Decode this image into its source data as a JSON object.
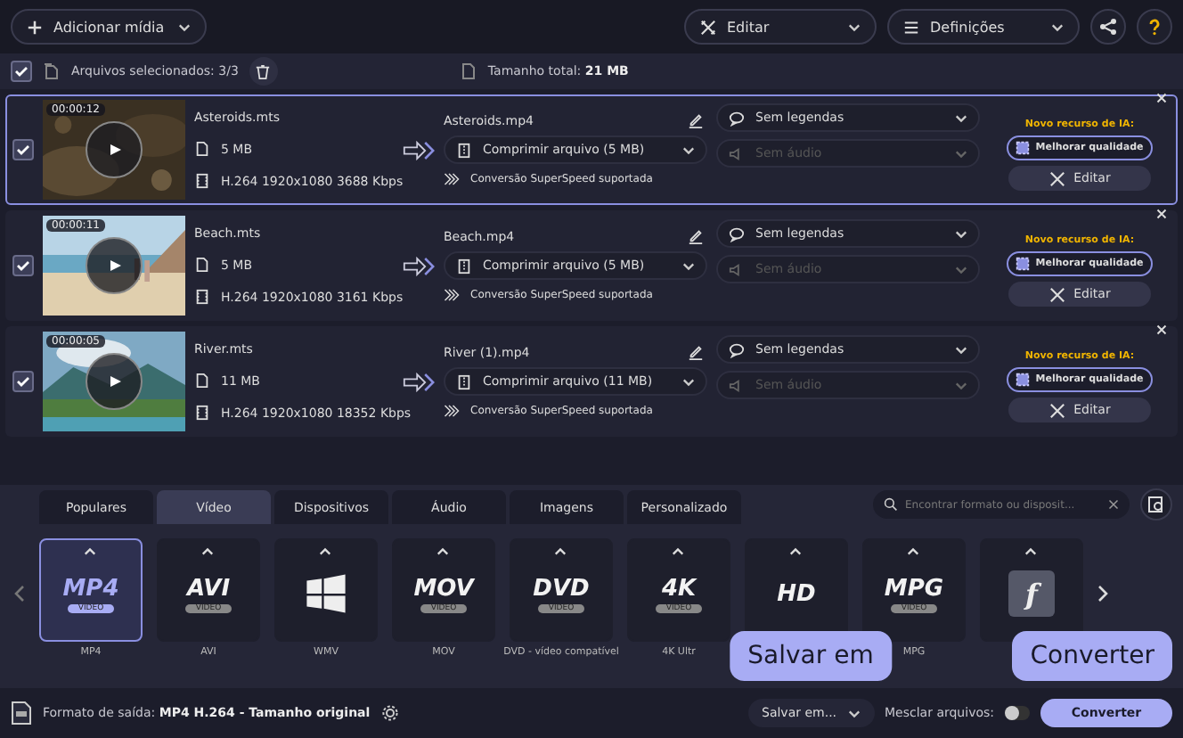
{
  "toolbar": {
    "add_media": "Adicionar mídia",
    "edit": "Editar",
    "settings": "Definições"
  },
  "selection_bar": {
    "checked": true,
    "selected_files": "Arquivos selecionados: 3/3",
    "total_label": "Tamanho total:",
    "total_value": "21 MB"
  },
  "files": [
    {
      "selected": true,
      "checked": true,
      "duration": "00:00:12",
      "source": "Asteroids.mts",
      "size": "5 MB",
      "codec": "H.264 1920x1080 3688 Kbps",
      "output": "Asteroids.mp4",
      "compress": "Comprimir arquivo (5 MB)",
      "speed": "Conversão SuperSpeed suportada",
      "subtitles": "Sem legendas",
      "audio": "Sem áudio",
      "audio_disabled": true,
      "ai_label": "Novo recurso de IA:",
      "enhance": "Melhorar qualidade",
      "edit": "Editar"
    },
    {
      "selected": false,
      "checked": true,
      "duration": "00:00:11",
      "source": "Beach.mts",
      "size": "5 MB",
      "codec": "H.264 1920x1080 3161 Kbps",
      "output": "Beach.mp4",
      "compress": "Comprimir arquivo (5 MB)",
      "speed": "Conversão SuperSpeed suportada",
      "subtitles": "Sem legendas",
      "audio": "Sem áudio",
      "audio_disabled": true,
      "ai_label": "Novo recurso de IA:",
      "enhance": "Melhorar qualidade",
      "edit": "Editar"
    },
    {
      "selected": false,
      "checked": true,
      "duration": "00:00:05",
      "source": "River.mts",
      "size": "11 MB",
      "codec": "H.264 1920x1080 18352 Kbps",
      "output": "River (1).mp4",
      "compress": "Comprimir arquivo (11 MB)",
      "speed": "Conversão SuperSpeed suportada",
      "subtitles": "Sem legendas",
      "audio": "Sem áudio",
      "audio_disabled": true,
      "ai_label": "Novo recurso de IA:",
      "enhance": "Melhorar qualidade",
      "edit": "Editar"
    }
  ],
  "format_tabs": [
    {
      "label": "Populares",
      "selected": false
    },
    {
      "label": "Vídeo",
      "selected": true
    },
    {
      "label": "Dispositivos",
      "selected": false
    },
    {
      "label": "Áudio",
      "selected": false
    },
    {
      "label": "Imagens",
      "selected": false
    },
    {
      "label": "Personalizado",
      "selected": false
    }
  ],
  "format_search": {
    "placeholder": "Encontrar formato ou disposit..."
  },
  "formats": [
    {
      "kind": "text",
      "logo": "MP4",
      "sub": "VIDEO",
      "label": "MP4",
      "selected": true
    },
    {
      "kind": "text",
      "logo": "AVI",
      "sub": "VIDEO",
      "label": "AVI",
      "selected": false
    },
    {
      "kind": "windows",
      "label": "WMV",
      "selected": false
    },
    {
      "kind": "text",
      "logo": "MOV",
      "sub": "VIDEO",
      "label": "MOV",
      "selected": false
    },
    {
      "kind": "text",
      "logo": "DVD",
      "sub": "VIDEO",
      "label": "DVD - vídeo compatível",
      "selected": false
    },
    {
      "kind": "text",
      "logo": "4K",
      "sub": "VIDEO",
      "label": "4K Ultr",
      "selected": false
    },
    {
      "kind": "text",
      "logo": "HD",
      "selected": false
    },
    {
      "kind": "text",
      "logo": "MPG",
      "sub": "VIDEO",
      "label": "MPG",
      "selected": false
    },
    {
      "kind": "flash",
      "logo": "f",
      "selected": false
    }
  ],
  "bottom_bar": {
    "output_label": "Formato de saída:",
    "output_value": "MP4 H.264 - Tamanho original",
    "save_to": "Salvar em...",
    "merge_label": "Mesclar arquivos:",
    "merge_on": false,
    "convert": "Converter"
  },
  "tooltips": {
    "save": "Salvar em",
    "convert": "Converter"
  }
}
